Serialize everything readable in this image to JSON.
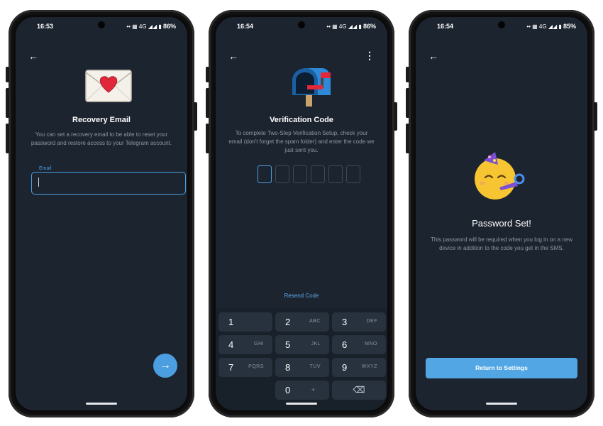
{
  "screens": [
    {
      "status": {
        "time": "16:53",
        "left_icons": "◀ ■ ⬛ •",
        "right_icons": "•• ▦ 4G ◢◢ ▮",
        "battery": "86%"
      },
      "title": "Recovery Email",
      "description": "You can set a recovery email to be able to reset your password and restore access to your Telegram account.",
      "email_label": "Email",
      "email_value": "",
      "next_icon": "arrow-right-icon",
      "back_icon": "back-arrow-icon",
      "illustration": "love-letter-emoji"
    },
    {
      "status": {
        "time": "16:54",
        "left_icons": "◀ ■ ⬛ •",
        "right_icons": "•• ▦ 4G ◢◢ ▮",
        "battery": "86%"
      },
      "title": "Verification Code",
      "description": "To complete Two-Step Verification Setup, check your email (don't forget the spam folder) and enter the code we just sent you.",
      "resend_label": "Resend Code",
      "code_length": 6,
      "back_icon": "back-arrow-icon",
      "menu_icon": "more-vertical-icon",
      "illustration": "mailbox-emoji",
      "keypad": [
        {
          "digit": "1",
          "letters": ""
        },
        {
          "digit": "2",
          "letters": "ABC"
        },
        {
          "digit": "3",
          "letters": "DEF"
        },
        {
          "digit": "4",
          "letters": "GHI"
        },
        {
          "digit": "5",
          "letters": "JKL"
        },
        {
          "digit": "6",
          "letters": "MNO"
        },
        {
          "digit": "7",
          "letters": "PQRS"
        },
        {
          "digit": "8",
          "letters": "TUV"
        },
        {
          "digit": "9",
          "letters": "WXYZ"
        },
        {
          "digit": "0",
          "letters": "+"
        }
      ]
    },
    {
      "status": {
        "time": "16:54",
        "left_icons": "◀ ■ ⬛ •",
        "right_icons": "•• ▦ 4G ◢◢ ▮",
        "battery": "85%"
      },
      "title": "Password Set!",
      "description": "This password will be required when you log in on a new device in addition to the code you get in the SMS.",
      "button_label": "Return to Settings",
      "back_icon": "back-arrow-icon",
      "illustration": "party-face-emoji"
    }
  ],
  "colors": {
    "background": "#1c2430",
    "accent": "#4b9fe0",
    "keypad_key": "#28323e",
    "muted_text": "#8c97a3"
  }
}
